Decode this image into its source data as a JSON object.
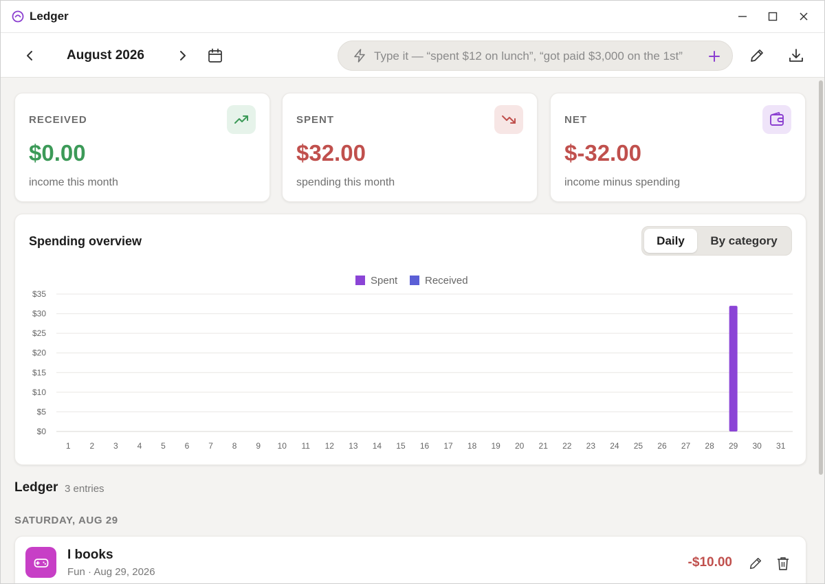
{
  "app": {
    "title": "Ledger",
    "accent": "#8b3fd0"
  },
  "toolbar": {
    "month": "August 2026",
    "quick_entry_placeholder": "Type it — “spent $12 on lunch”, “got paid $3,000 on the 1st”"
  },
  "stats": {
    "received": {
      "label": "RECEIVED",
      "value": "$0.00",
      "sub": "income this month",
      "color": "#3c9a58",
      "icon": "trending-up-icon"
    },
    "spent": {
      "label": "SPENT",
      "value": "$32.00",
      "sub": "spending this month",
      "color": "#c0504d",
      "icon": "trending-down-icon"
    },
    "net": {
      "label": "NET",
      "value": "$-32.00",
      "sub": "income minus spending",
      "color": "#c0504d",
      "icon": "wallet-icon"
    }
  },
  "overview": {
    "title": "Spending overview",
    "tabs": [
      "Daily",
      "By category"
    ],
    "active_tab": "Daily"
  },
  "chart_data": {
    "type": "bar",
    "categories": [
      "1",
      "2",
      "3",
      "4",
      "5",
      "6",
      "7",
      "8",
      "9",
      "10",
      "11",
      "12",
      "13",
      "14",
      "15",
      "16",
      "17",
      "18",
      "19",
      "20",
      "21",
      "22",
      "23",
      "24",
      "25",
      "26",
      "27",
      "28",
      "29",
      "30",
      "31"
    ],
    "series": [
      {
        "name": "Spent",
        "color": "#8b44d6",
        "values": [
          0,
          0,
          0,
          0,
          0,
          0,
          0,
          0,
          0,
          0,
          0,
          0,
          0,
          0,
          0,
          0,
          0,
          0,
          0,
          0,
          0,
          0,
          0,
          0,
          0,
          0,
          0,
          0,
          32,
          0,
          0
        ]
      },
      {
        "name": "Received",
        "color": "#5b5fd6",
        "values": [
          0,
          0,
          0,
          0,
          0,
          0,
          0,
          0,
          0,
          0,
          0,
          0,
          0,
          0,
          0,
          0,
          0,
          0,
          0,
          0,
          0,
          0,
          0,
          0,
          0,
          0,
          0,
          0,
          0,
          0,
          0
        ]
      }
    ],
    "yticks": [
      "$0",
      "$5",
      "$10",
      "$15",
      "$20",
      "$25",
      "$30",
      "$35"
    ],
    "ylim": [
      0,
      35
    ],
    "grid": true,
    "legend": "top-center"
  },
  "ledger": {
    "title": "Ledger",
    "count": "3 entries",
    "groups": [
      {
        "day": "SATURDAY, AUG 29",
        "entries": [
          {
            "name": "I books",
            "meta": "Fun · Aug 29, 2026",
            "amount": "-$10.00",
            "icon": "gamepad-icon",
            "icon_color": "#c73fc6"
          }
        ]
      }
    ]
  }
}
